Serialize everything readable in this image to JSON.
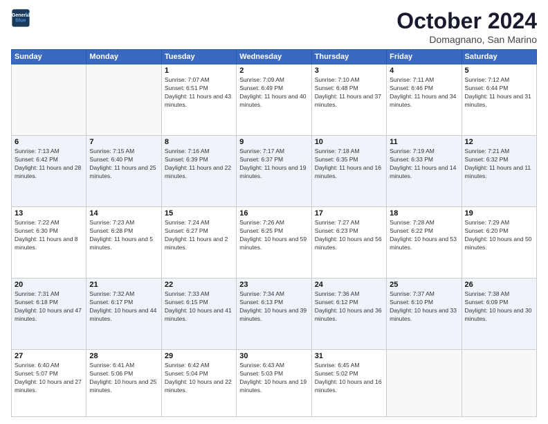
{
  "header": {
    "logo_line1": "General",
    "logo_line2": "Blue",
    "month": "October 2024",
    "location": "Domagnano, San Marino"
  },
  "days_of_week": [
    "Sunday",
    "Monday",
    "Tuesday",
    "Wednesday",
    "Thursday",
    "Friday",
    "Saturday"
  ],
  "weeks": [
    [
      {
        "day": "",
        "info": ""
      },
      {
        "day": "",
        "info": ""
      },
      {
        "day": "1",
        "info": "Sunrise: 7:07 AM\nSunset: 6:51 PM\nDaylight: 11 hours and 43 minutes."
      },
      {
        "day": "2",
        "info": "Sunrise: 7:09 AM\nSunset: 6:49 PM\nDaylight: 11 hours and 40 minutes."
      },
      {
        "day": "3",
        "info": "Sunrise: 7:10 AM\nSunset: 6:48 PM\nDaylight: 11 hours and 37 minutes."
      },
      {
        "day": "4",
        "info": "Sunrise: 7:11 AM\nSunset: 6:46 PM\nDaylight: 11 hours and 34 minutes."
      },
      {
        "day": "5",
        "info": "Sunrise: 7:12 AM\nSunset: 6:44 PM\nDaylight: 11 hours and 31 minutes."
      }
    ],
    [
      {
        "day": "6",
        "info": "Sunrise: 7:13 AM\nSunset: 6:42 PM\nDaylight: 11 hours and 28 minutes."
      },
      {
        "day": "7",
        "info": "Sunrise: 7:15 AM\nSunset: 6:40 PM\nDaylight: 11 hours and 25 minutes."
      },
      {
        "day": "8",
        "info": "Sunrise: 7:16 AM\nSunset: 6:39 PM\nDaylight: 11 hours and 22 minutes."
      },
      {
        "day": "9",
        "info": "Sunrise: 7:17 AM\nSunset: 6:37 PM\nDaylight: 11 hours and 19 minutes."
      },
      {
        "day": "10",
        "info": "Sunrise: 7:18 AM\nSunset: 6:35 PM\nDaylight: 11 hours and 16 minutes."
      },
      {
        "day": "11",
        "info": "Sunrise: 7:19 AM\nSunset: 6:33 PM\nDaylight: 11 hours and 14 minutes."
      },
      {
        "day": "12",
        "info": "Sunrise: 7:21 AM\nSunset: 6:32 PM\nDaylight: 11 hours and 11 minutes."
      }
    ],
    [
      {
        "day": "13",
        "info": "Sunrise: 7:22 AM\nSunset: 6:30 PM\nDaylight: 11 hours and 8 minutes."
      },
      {
        "day": "14",
        "info": "Sunrise: 7:23 AM\nSunset: 6:28 PM\nDaylight: 11 hours and 5 minutes."
      },
      {
        "day": "15",
        "info": "Sunrise: 7:24 AM\nSunset: 6:27 PM\nDaylight: 11 hours and 2 minutes."
      },
      {
        "day": "16",
        "info": "Sunrise: 7:26 AM\nSunset: 6:25 PM\nDaylight: 10 hours and 59 minutes."
      },
      {
        "day": "17",
        "info": "Sunrise: 7:27 AM\nSunset: 6:23 PM\nDaylight: 10 hours and 56 minutes."
      },
      {
        "day": "18",
        "info": "Sunrise: 7:28 AM\nSunset: 6:22 PM\nDaylight: 10 hours and 53 minutes."
      },
      {
        "day": "19",
        "info": "Sunrise: 7:29 AM\nSunset: 6:20 PM\nDaylight: 10 hours and 50 minutes."
      }
    ],
    [
      {
        "day": "20",
        "info": "Sunrise: 7:31 AM\nSunset: 6:18 PM\nDaylight: 10 hours and 47 minutes."
      },
      {
        "day": "21",
        "info": "Sunrise: 7:32 AM\nSunset: 6:17 PM\nDaylight: 10 hours and 44 minutes."
      },
      {
        "day": "22",
        "info": "Sunrise: 7:33 AM\nSunset: 6:15 PM\nDaylight: 10 hours and 41 minutes."
      },
      {
        "day": "23",
        "info": "Sunrise: 7:34 AM\nSunset: 6:13 PM\nDaylight: 10 hours and 39 minutes."
      },
      {
        "day": "24",
        "info": "Sunrise: 7:36 AM\nSunset: 6:12 PM\nDaylight: 10 hours and 36 minutes."
      },
      {
        "day": "25",
        "info": "Sunrise: 7:37 AM\nSunset: 6:10 PM\nDaylight: 10 hours and 33 minutes."
      },
      {
        "day": "26",
        "info": "Sunrise: 7:38 AM\nSunset: 6:09 PM\nDaylight: 10 hours and 30 minutes."
      }
    ],
    [
      {
        "day": "27",
        "info": "Sunrise: 6:40 AM\nSunset: 5:07 PM\nDaylight: 10 hours and 27 minutes."
      },
      {
        "day": "28",
        "info": "Sunrise: 6:41 AM\nSunset: 5:06 PM\nDaylight: 10 hours and 25 minutes."
      },
      {
        "day": "29",
        "info": "Sunrise: 6:42 AM\nSunset: 5:04 PM\nDaylight: 10 hours and 22 minutes."
      },
      {
        "day": "30",
        "info": "Sunrise: 6:43 AM\nSunset: 5:03 PM\nDaylight: 10 hours and 19 minutes."
      },
      {
        "day": "31",
        "info": "Sunrise: 6:45 AM\nSunset: 5:02 PM\nDaylight: 10 hours and 16 minutes."
      },
      {
        "day": "",
        "info": ""
      },
      {
        "day": "",
        "info": ""
      }
    ]
  ]
}
